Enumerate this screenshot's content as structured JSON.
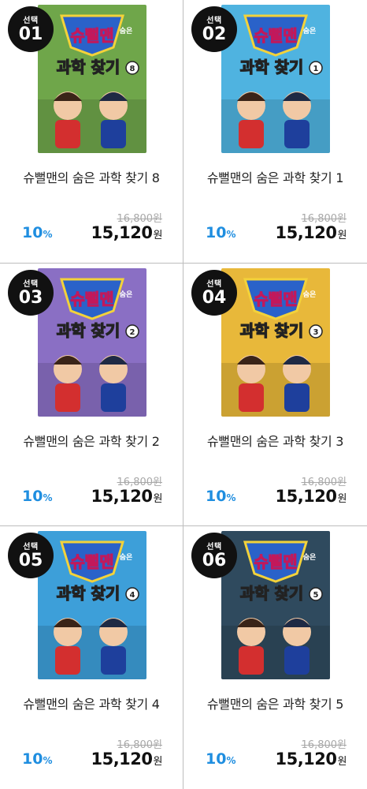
{
  "select_label": "선택",
  "currency": "원",
  "percent": "%",
  "products": [
    {
      "num": "01",
      "title": "슈뻘맨의 숨은 과학 찾기 8",
      "volume": "8",
      "original_price": "16,800",
      "discount": "10",
      "price": "15,120",
      "cover_color": "#6fa64a"
    },
    {
      "num": "02",
      "title": "슈뻘맨의 숨은 과학 찾기 1",
      "volume": "1",
      "original_price": "16,800",
      "discount": "10",
      "price": "15,120",
      "cover_color": "#4fb3e0"
    },
    {
      "num": "03",
      "title": "슈뻘맨의 숨은 과학 찾기 2",
      "volume": "2",
      "original_price": "16,800",
      "discount": "10",
      "price": "15,120",
      "cover_color": "#8a6fc4"
    },
    {
      "num": "04",
      "title": "슈뻘맨의 숨은 과학 찾기 3",
      "volume": "3",
      "original_price": "16,800",
      "discount": "10",
      "price": "15,120",
      "cover_color": "#e8b83a"
    },
    {
      "num": "05",
      "title": "슈뻘맨의 숨은 과학 찾기 4",
      "volume": "4",
      "original_price": "16,800",
      "discount": "10",
      "price": "15,120",
      "cover_color": "#3d9fd9"
    },
    {
      "num": "06",
      "title": "슈뻘맨의 숨은 과학 찾기 5",
      "volume": "5",
      "original_price": "16,800",
      "discount": "10",
      "price": "15,120",
      "cover_color": "#2f4a5e"
    }
  ],
  "cover_text": {
    "logo": "슈뻘맨",
    "subtitle": "숨은",
    "title": "과학 찾기"
  }
}
